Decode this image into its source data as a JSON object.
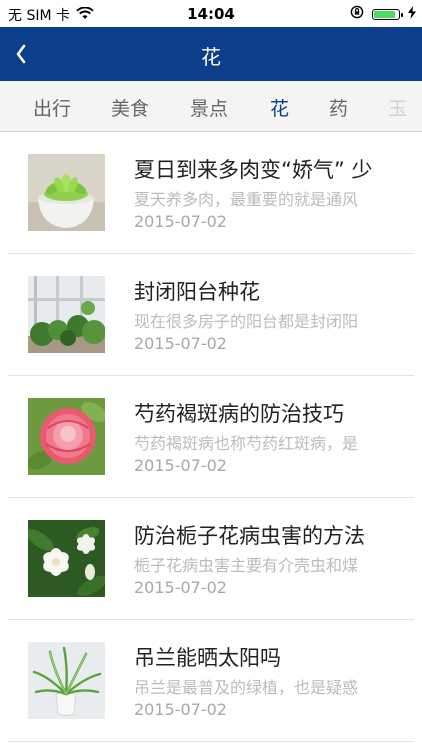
{
  "status_bar": {
    "carrier": "无 SIM 卡",
    "time": "14:04",
    "battery_level": 0.9
  },
  "nav": {
    "title": "花",
    "back_icon": "chevron-left-icon"
  },
  "tabs": [
    {
      "label": "出行",
      "active": false
    },
    {
      "label": "美食",
      "active": false
    },
    {
      "label": "景点",
      "active": false
    },
    {
      "label": "花",
      "active": true
    },
    {
      "label": "药",
      "active": false
    },
    {
      "label": "玉",
      "active": false
    }
  ],
  "articles": [
    {
      "title": "夏日到来多肉变“娇气” 少",
      "summary": "夏天养多肉，最重要的就是通风",
      "date": "2015-07-02",
      "image": "succulent-photo"
    },
    {
      "title": "封闭阳台种花",
      "summary": "现在很多房子的阳台都是封闭阳",
      "date": "2015-07-02",
      "image": "balcony-plants-photo"
    },
    {
      "title": "芍药褐斑病的防治技巧",
      "summary": "芍药褐斑病也称芍药红斑病，是",
      "date": "2015-07-02",
      "image": "peony-photo"
    },
    {
      "title": "防治栀子花病虫害的方法",
      "summary": "栀子花病虫害主要有介壳虫和煤",
      "date": "2015-07-02",
      "image": "gardenia-photo"
    },
    {
      "title": "吊兰能晒太阳吗",
      "summary": "吊兰是最普及的绿植，也是疑惑",
      "date": "2015-07-02",
      "image": "spider-plant-photo"
    }
  ],
  "colors": {
    "nav_background": "#0d3e8c",
    "active_tab": "#0d3e8c"
  }
}
